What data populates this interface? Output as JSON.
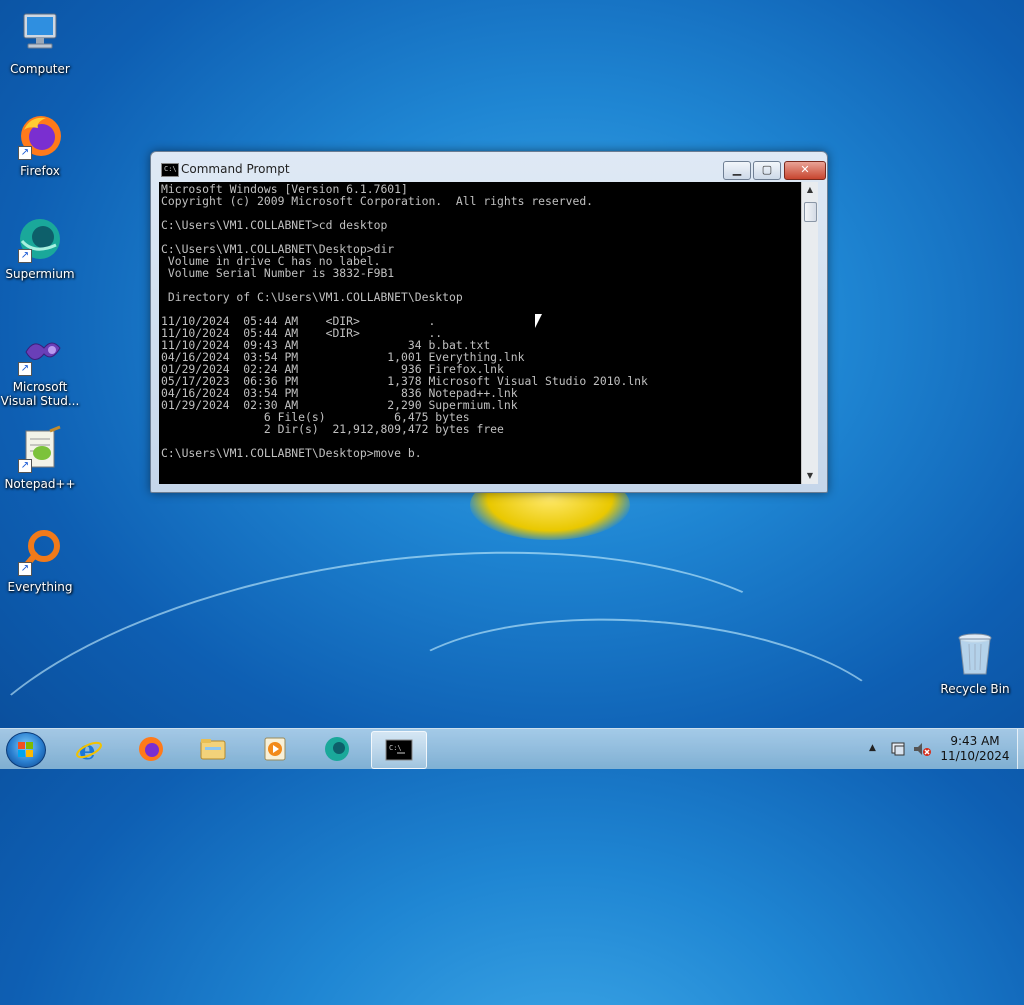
{
  "desktop": {
    "icons": [
      {
        "label": "Computer"
      },
      {
        "label": "Firefox"
      },
      {
        "label": "Supermium"
      },
      {
        "label": "Microsoft Visual Stud..."
      },
      {
        "label": "Notepad++"
      },
      {
        "label": "Everything"
      },
      {
        "label": "Recycle Bin"
      }
    ]
  },
  "cmd": {
    "title": "Command Prompt",
    "lines": [
      "Microsoft Windows [Version 6.1.7601]",
      "Copyright (c) 2009 Microsoft Corporation.  All rights reserved.",
      "",
      "C:\\Users\\VM1.COLLABNET>cd desktop",
      "",
      "C:\\Users\\VM1.COLLABNET\\Desktop>dir",
      " Volume in drive C has no label.",
      " Volume Serial Number is 3832-F9B1",
      "",
      " Directory of C:\\Users\\VM1.COLLABNET\\Desktop",
      "",
      "11/10/2024  05:44 AM    <DIR>          .",
      "11/10/2024  05:44 AM    <DIR>          ..",
      "11/10/2024  09:43 AM                34 b.bat.txt",
      "04/16/2024  03:54 PM             1,001 Everything.lnk",
      "01/29/2024  02:24 AM               936 Firefox.lnk",
      "05/17/2023  06:36 PM             1,378 Microsoft Visual Studio 2010.lnk",
      "04/16/2024  03:54 PM               836 Notepad++.lnk",
      "01/29/2024  02:30 AM             2,290 Supermium.lnk",
      "               6 File(s)          6,475 bytes",
      "               2 Dir(s)  21,912,809,472 bytes free",
      "",
      "C:\\Users\\VM1.COLLABNET\\Desktop>move b."
    ]
  },
  "taskbar": {
    "clock_time": "9:43 AM",
    "clock_date": "11/10/2024"
  },
  "colors": {
    "console_bg": "#000000",
    "console_fg": "#c0c0c0",
    "close_button": "#c7452f"
  }
}
